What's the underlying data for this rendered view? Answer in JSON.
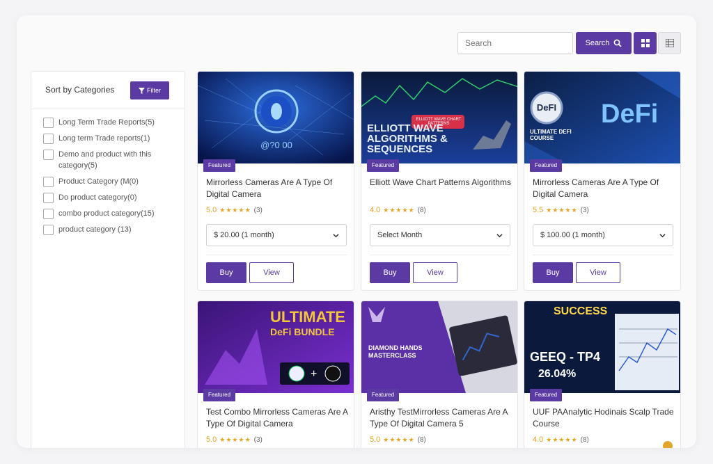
{
  "topbar": {
    "search_placeholder": "Search",
    "search_button": "Search"
  },
  "sidebar": {
    "title": "Sort by Categories",
    "filter_button": "Filter",
    "categories": [
      "Long Term Trade Reports(5)",
      "Long term Trade reports(1)",
      "Demo and product with this category(5)",
      "Product Category (M(0)",
      "Do product category(0)",
      "combo product category(15)",
      "product category (13)"
    ]
  },
  "products": [
    {
      "badge": "Featured",
      "title": "Mirrorless Cameras Are A Type Of Digital Camera",
      "rating": "5.0",
      "stars": "★★★★★",
      "count": "(3)",
      "plan": "$ 20.00 (1 month)",
      "buy": "Buy",
      "view": "View",
      "image_text": "@?0 00"
    },
    {
      "badge": "Featured",
      "title": "Elliott Wave Chart Patterns Algorithms",
      "rating": "4.0",
      "stars": "★★★★★",
      "count": "(8)",
      "plan": "Select Month",
      "buy": "Buy",
      "view": "View",
      "image_text": "ELLIOTT WAVE ALGORITHMS & SEQUENCES",
      "image_tag": "ELLIOTT WAVE CHART PATTERNS"
    },
    {
      "badge": "Featured",
      "title": "Mirrorless Cameras Are A Type Of Digital Camera",
      "rating": "5.5",
      "stars": "★★★★★",
      "count": "(3)",
      "plan": "$ 100.00 (1 month)",
      "buy": "Buy",
      "view": "View",
      "image_text": "DeFi",
      "image_circle": "DeFI",
      "image_sub": "ULTIMATE DEFI COURSE"
    },
    {
      "badge": "Featured",
      "title": "Test Combo Mirrorless Cameras Are A Type Of Digital Camera",
      "rating": "5.0",
      "stars": "★★★★★",
      "count": "(3)",
      "image_text": "ULTIMATE",
      "image_sub": "DeFi BUNDLE"
    },
    {
      "badge": "Featured",
      "title": "Aristhy TestMirrorless Cameras Are A Type Of Digital Camera 5",
      "rating": "5.0",
      "stars": "★★★★★",
      "count": "(8)",
      "image_text": "DIAMOND HANDS MASTERCLASS"
    },
    {
      "badge": "Featured",
      "title": "UUF PAAnalytic Hodinais Scalp Trade Course",
      "rating": "4.0",
      "stars": "★★★★★",
      "count": "(8)",
      "image_text": "SUCCESS",
      "image_sub": "GEEQ - TP4",
      "image_pct": "26.04%"
    }
  ],
  "colors": {
    "accent": "#5b3aa3",
    "star": "#e4a321"
  }
}
